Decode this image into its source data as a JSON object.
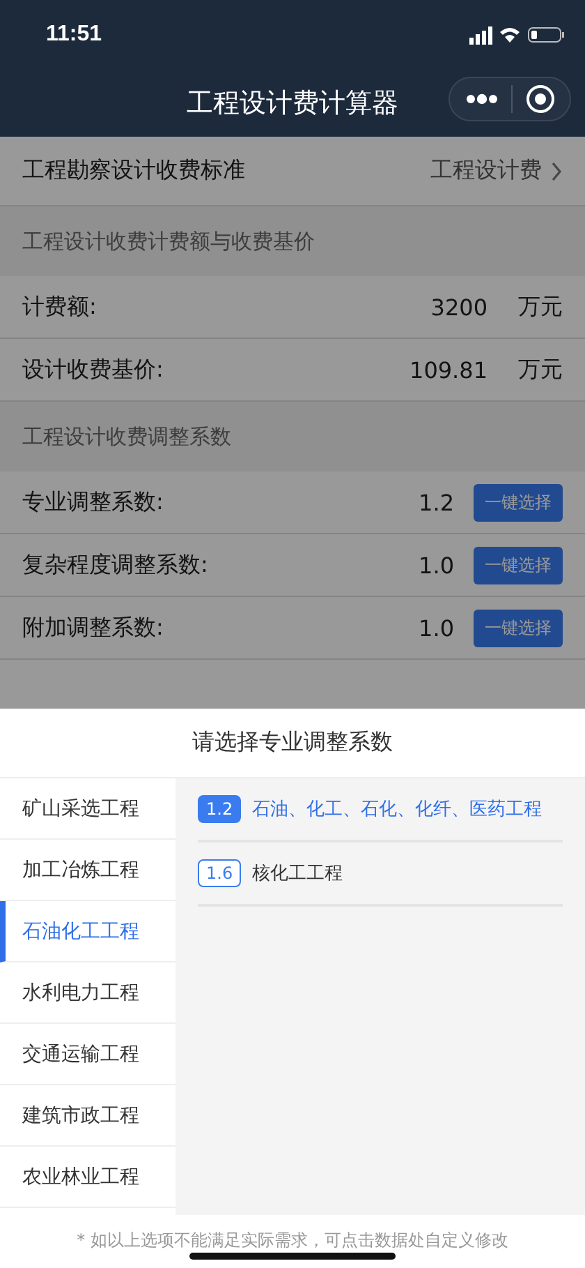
{
  "status_bar": {
    "time": "11:51"
  },
  "nav": {
    "title": "工程设计费计算器"
  },
  "standard_row": {
    "label": "工程勘察设计收费标准",
    "value": "工程设计费"
  },
  "sections": [
    {
      "title": "工程设计收费计费额与收费基价",
      "rows": [
        {
          "kind": "amount",
          "label": "计费额:",
          "value": "3200",
          "unit": "万元"
        },
        {
          "kind": "amount",
          "label": "设计收费基价:",
          "value": "109.81",
          "unit": "万元"
        }
      ]
    },
    {
      "title": "工程设计收费调整系数",
      "rows": [
        {
          "kind": "factor",
          "label": "专业调整系数:",
          "value": "1.2",
          "button": "一键选择"
        },
        {
          "kind": "factor",
          "label": "复杂程度调整系数:",
          "value": "1.0",
          "button": "一键选择"
        },
        {
          "kind": "factor",
          "label": "附加调整系数:",
          "value": "1.0",
          "button": "一键选择"
        }
      ]
    }
  ],
  "sheet": {
    "title": "请选择专业调整系数",
    "categories": [
      {
        "label": "矿山采选工程",
        "selected": false
      },
      {
        "label": "加工冶炼工程",
        "selected": false
      },
      {
        "label": "石油化工工程",
        "selected": true
      },
      {
        "label": "水利电力工程",
        "selected": false
      },
      {
        "label": "交通运输工程",
        "selected": false
      },
      {
        "label": "建筑市政工程",
        "selected": false
      },
      {
        "label": "农业林业工程",
        "selected": false
      }
    ],
    "options": [
      {
        "value": "1.2",
        "label": "石油、化工、石化、化纤、医药工程",
        "selected": true
      },
      {
        "value": "1.6",
        "label": "核化工工程",
        "selected": false
      }
    ],
    "note": "* 如以上选项不能满足实际需求，可点击数据处自定义修改"
  }
}
